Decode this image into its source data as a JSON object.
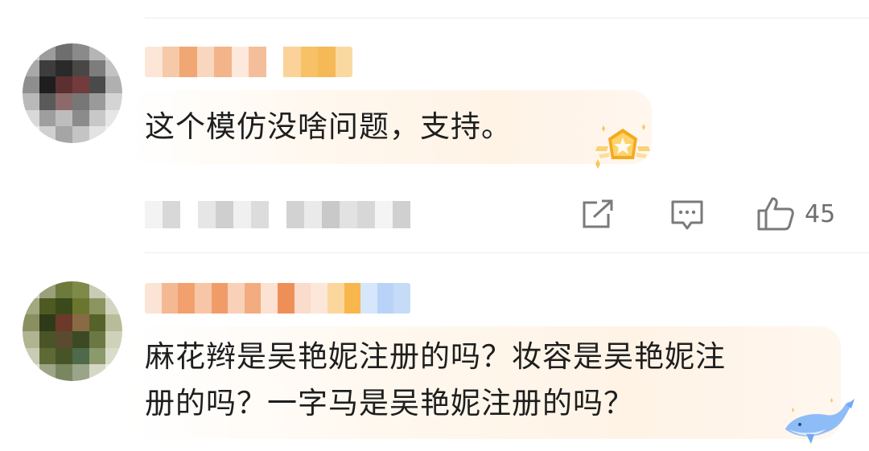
{
  "comments": [
    {
      "text": "这个模仿没啥问题，支持。",
      "icons": {
        "share": "share-icon",
        "reply": "reply-icon",
        "like": "like-icon"
      },
      "like_count": "45",
      "badge": "star-badge-icon"
    },
    {
      "text_line1": "麻花辫是吴艳妮注册的吗？妆容是吴艳妮注",
      "text_line2": "册的吗？一字马是吴艳妮注册的吗？",
      "badge": "whale-badge-icon"
    }
  ],
  "colors": {
    "bubble_accent": "#fff3e6",
    "icon_gray": "#7a7a7a",
    "badge_gold": "#f6b92b",
    "whale_blue": "#6fa8f5"
  }
}
